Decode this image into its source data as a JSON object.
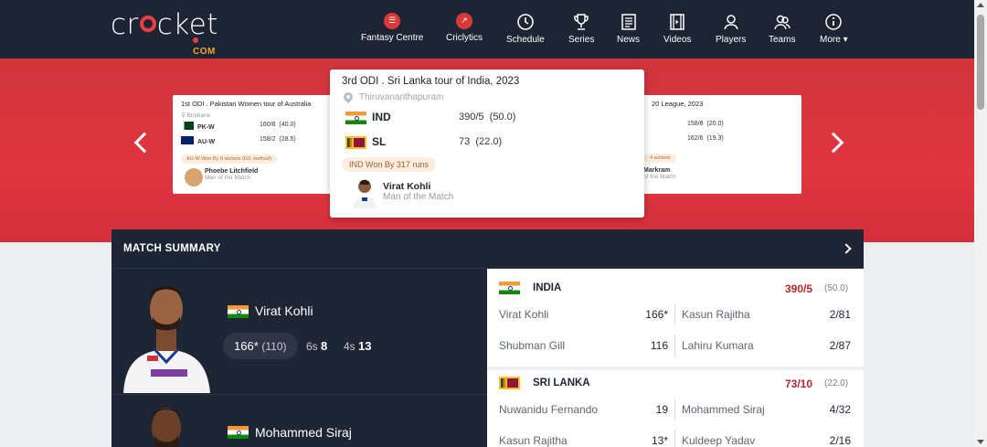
{
  "nav": {
    "logo_word": "cricket",
    "logo_sub": "COM",
    "items": [
      {
        "label": "Fantasy Centre",
        "icon": "fantasy-icon"
      },
      {
        "label": "Criclytics",
        "icon": "criclytics-icon"
      },
      {
        "label": "Schedule",
        "icon": "clock-icon"
      },
      {
        "label": "Series",
        "icon": "trophy-icon"
      },
      {
        "label": "News",
        "icon": "newspaper-icon"
      },
      {
        "label": "Videos",
        "icon": "film-icon"
      },
      {
        "label": "Players",
        "icon": "player-icon"
      },
      {
        "label": "Teams",
        "icon": "team-icon"
      },
      {
        "label": "More",
        "icon": "info-icon"
      }
    ]
  },
  "carousel": {
    "left_card": {
      "title": "1st ODI . Pakistan Women tour of Australia",
      "venue": "Brisbane",
      "team1": {
        "name": "PK-W",
        "score": "160/8",
        "overs": "(40.0)"
      },
      "team2": {
        "name": "AU-W",
        "score": "158/2",
        "overs": "(28.5)"
      },
      "result": "AU-W Won By 8 wickets (D/L method)",
      "mom_name": "Phoebe Litchfield",
      "mom_label": "Man of the Match"
    },
    "main_card": {
      "title": "3rd ODI . Sri Lanka tour of India, 2023",
      "venue": "Thiruvananthapuram",
      "team1": {
        "name": "IND",
        "score": "390/5",
        "overs": "(50.0)"
      },
      "team2": {
        "name": "SL",
        "score": "73",
        "overs": "(22.0)"
      },
      "result": "IND Won By 317 runs",
      "mom_name": "Virat Kohli",
      "mom_label": "Man of the Match"
    },
    "right_card": {
      "title": "20 League, 2023",
      "score1": "158/8",
      "overs1": "(20.0)",
      "score2": "162/6",
      "overs2": "(19.3)",
      "result": "4 wickets",
      "mom_name": "Markram",
      "mom_label": "of the Match"
    }
  },
  "summary": {
    "heading": "MATCH SUMMARY",
    "performers": [
      {
        "name": "Virat Kohli",
        "runs": "166*",
        "balls": "(110)",
        "sixes_label": "6s",
        "sixes": "8",
        "fours_label": "4s",
        "fours": "13"
      },
      {
        "name": "Mohammed Siraj"
      }
    ],
    "innings": [
      {
        "team": "INDIA",
        "total": "390/5",
        "overs": "(50.0)",
        "rows": [
          {
            "batter": "Virat Kohli",
            "runs": "166*",
            "bowler": "Kasun Rajitha",
            "figures": "2/81"
          },
          {
            "batter": "Shubman Gill",
            "runs": "116",
            "bowler": "Lahiru Kumara",
            "figures": "2/87"
          }
        ]
      },
      {
        "team": "SRI LANKA",
        "total": "73/10",
        "overs": "(22.0)",
        "rows": [
          {
            "batter": "Nuwanidu Fernando",
            "runs": "19",
            "bowler": "Mohammed Siraj",
            "figures": "4/32"
          },
          {
            "batter": "Kasun Rajitha",
            "runs": "13*",
            "bowler": "Kuldeep Yadav",
            "figures": "2/16"
          }
        ]
      }
    ]
  },
  "colors": {
    "nav_bg": "#1d2433",
    "band_red": "#d8353e",
    "accent_red": "#b8262b",
    "summary_bg": "#1e2534"
  }
}
